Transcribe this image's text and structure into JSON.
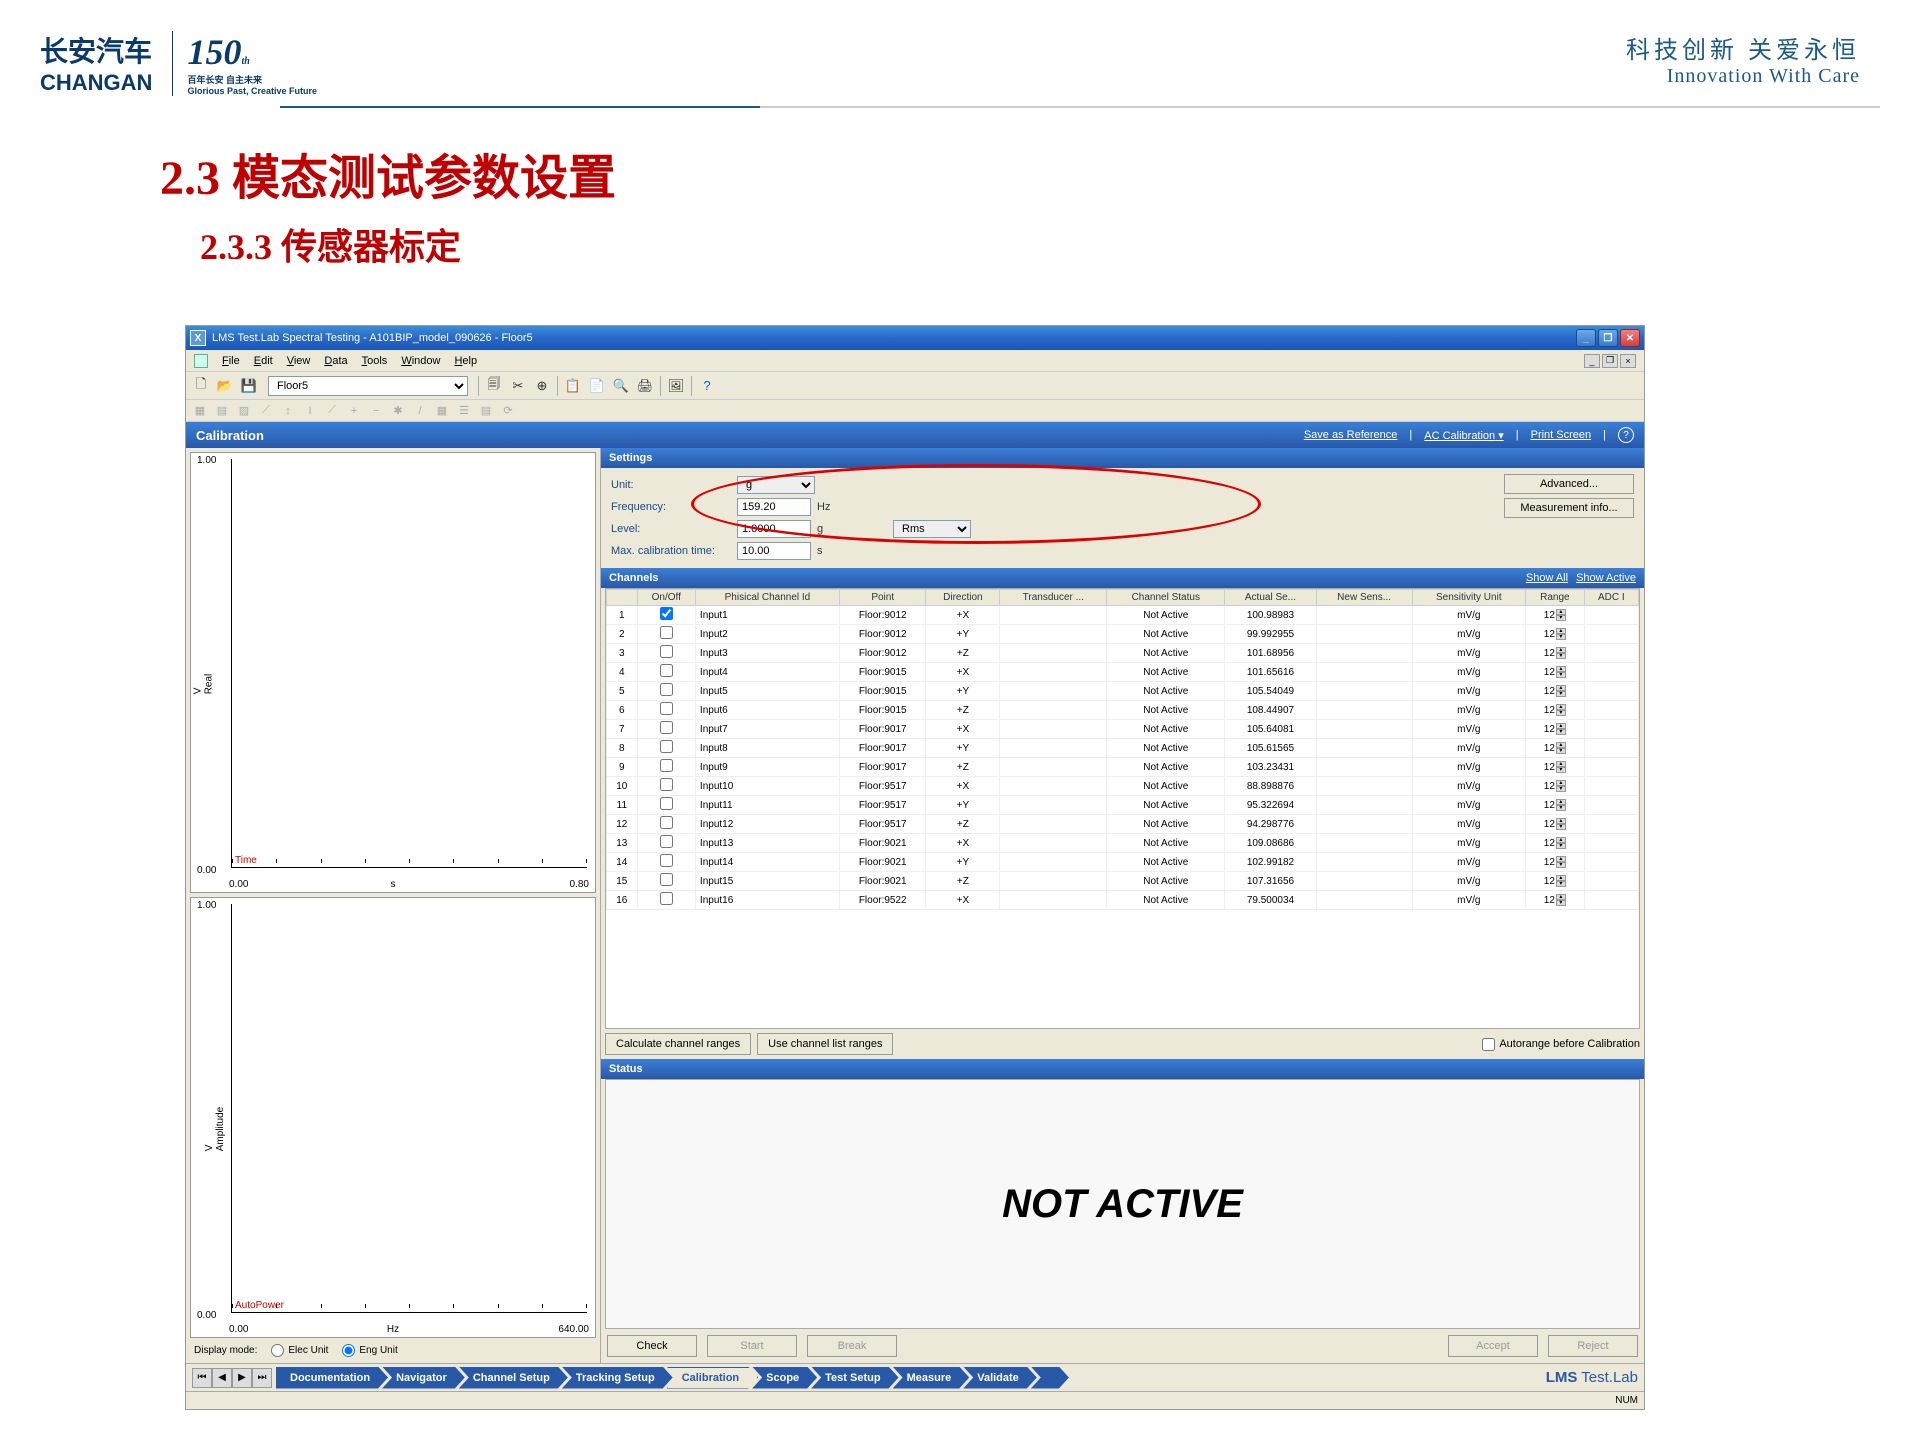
{
  "slide": {
    "logo_cn": "长安汽车",
    "logo_en": "CHANGAN",
    "logo_150": "150",
    "logo_sub1": "百年长安  自主未来",
    "logo_sub2": "Glorious Past, Creative Future",
    "slogan_cn": "科技创新  关爱永恒",
    "slogan_en": "Innovation With Care",
    "title": "2.3 模态测试参数设置",
    "subtitle": "2.3.3 传感器标定"
  },
  "window": {
    "title": "LMS Test.Lab Spectral Testing - A101BIP_model_090626 - Floor5",
    "section_dropdown": "Floor5"
  },
  "menus": [
    "File",
    "Edit",
    "View",
    "Data",
    "Tools",
    "Window",
    "Help"
  ],
  "calibration": {
    "header": "Calibration",
    "save_ref": "Save as Reference",
    "ac_cal": "AC Calibration",
    "print": "Print Screen"
  },
  "settings": {
    "header": "Settings",
    "unit_label": "Unit:",
    "unit_value": "g",
    "freq_label": "Frequency:",
    "freq_value": "159.20",
    "freq_unit": "Hz",
    "level_label": "Level:",
    "level_value": "1.0000",
    "level_unit": "g",
    "level_type": "Rms",
    "calib_label": "Max. calibration time:",
    "calib_value": "10.00",
    "calib_unit": "s",
    "btn_advanced": "Advanced...",
    "btn_measinfo": "Measurement info..."
  },
  "channels": {
    "header": "Channels",
    "show_all": "Show All",
    "show_active": "Show Active",
    "cols": [
      "",
      "On/Off",
      "Phisical Channel Id",
      "Point",
      "Direction",
      "Transducer ...",
      "Channel Status",
      "Actual Se...",
      "New Sens...",
      "Sensitivity Unit",
      "Range",
      "ADC I"
    ],
    "rows": [
      {
        "n": 1,
        "on": true,
        "id": "Input1",
        "point": "Floor:9012",
        "dir": "+X",
        "status": "Not Active",
        "actual": "100.98983",
        "sens": "mV/g",
        "range": "12"
      },
      {
        "n": 2,
        "on": false,
        "id": "Input2",
        "point": "Floor:9012",
        "dir": "+Y",
        "status": "Not Active",
        "actual": "99.992955",
        "sens": "mV/g",
        "range": "12"
      },
      {
        "n": 3,
        "on": false,
        "id": "Input3",
        "point": "Floor:9012",
        "dir": "+Z",
        "status": "Not Active",
        "actual": "101.68956",
        "sens": "mV/g",
        "range": "12"
      },
      {
        "n": 4,
        "on": false,
        "id": "Input4",
        "point": "Floor:9015",
        "dir": "+X",
        "status": "Not Active",
        "actual": "101.65616",
        "sens": "mV/g",
        "range": "12"
      },
      {
        "n": 5,
        "on": false,
        "id": "Input5",
        "point": "Floor:9015",
        "dir": "+Y",
        "status": "Not Active",
        "actual": "105.54049",
        "sens": "mV/g",
        "range": "12"
      },
      {
        "n": 6,
        "on": false,
        "id": "Input6",
        "point": "Floor:9015",
        "dir": "+Z",
        "status": "Not Active",
        "actual": "108.44907",
        "sens": "mV/g",
        "range": "12"
      },
      {
        "n": 7,
        "on": false,
        "id": "Input7",
        "point": "Floor:9017",
        "dir": "+X",
        "status": "Not Active",
        "actual": "105.64081",
        "sens": "mV/g",
        "range": "12"
      },
      {
        "n": 8,
        "on": false,
        "id": "Input8",
        "point": "Floor:9017",
        "dir": "+Y",
        "status": "Not Active",
        "actual": "105.61565",
        "sens": "mV/g",
        "range": "12"
      },
      {
        "n": 9,
        "on": false,
        "id": "Input9",
        "point": "Floor:9017",
        "dir": "+Z",
        "status": "Not Active",
        "actual": "103.23431",
        "sens": "mV/g",
        "range": "12"
      },
      {
        "n": 10,
        "on": false,
        "id": "Input10",
        "point": "Floor:9517",
        "dir": "+X",
        "status": "Not Active",
        "actual": "88.898876",
        "sens": "mV/g",
        "range": "12"
      },
      {
        "n": 11,
        "on": false,
        "id": "Input11",
        "point": "Floor:9517",
        "dir": "+Y",
        "status": "Not Active",
        "actual": "95.322694",
        "sens": "mV/g",
        "range": "12"
      },
      {
        "n": 12,
        "on": false,
        "id": "Input12",
        "point": "Floor:9517",
        "dir": "+Z",
        "status": "Not Active",
        "actual": "94.298776",
        "sens": "mV/g",
        "range": "12"
      },
      {
        "n": 13,
        "on": false,
        "id": "Input13",
        "point": "Floor:9021",
        "dir": "+X",
        "status": "Not Active",
        "actual": "109.08686",
        "sens": "mV/g",
        "range": "12"
      },
      {
        "n": 14,
        "on": false,
        "id": "Input14",
        "point": "Floor:9021",
        "dir": "+Y",
        "status": "Not Active",
        "actual": "102.99182",
        "sens": "mV/g",
        "range": "12"
      },
      {
        "n": 15,
        "on": false,
        "id": "Input15",
        "point": "Floor:9021",
        "dir": "+Z",
        "status": "Not Active",
        "actual": "107.31656",
        "sens": "mV/g",
        "range": "12"
      },
      {
        "n": 16,
        "on": false,
        "id": "Input16",
        "point": "Floor:9522",
        "dir": "+X",
        "status": "Not Active",
        "actual": "79.500034",
        "sens": "mV/g",
        "range": "12"
      }
    ],
    "btn_calc": "Calculate channel ranges",
    "btn_uselist": "Use channel list ranges",
    "chk_autorange": "Autorange before Calibration"
  },
  "status": {
    "header": "Status",
    "text": "NOT ACTIVE"
  },
  "actions": {
    "check": "Check",
    "start": "Start",
    "break": "Break",
    "accept": "Accept",
    "reject": "Reject"
  },
  "tabs": [
    "Documentation",
    "Navigator",
    "Channel Setup",
    "Tracking Setup",
    "Calibration",
    "Scope",
    "Test Setup",
    "Measure",
    "Validate"
  ],
  "tabs_active": "Calibration",
  "lms_brand": {
    "bold": "LMS",
    "rest": " Test.Lab"
  },
  "charts": {
    "c1": {
      "ytop": "1.00",
      "ybot": "0.00",
      "x0": "0.00",
      "x1": "0.80",
      "xlabel": "s",
      "ylabel": "V\nReal",
      "series": "Time"
    },
    "c2": {
      "ytop": "1.00",
      "ybot": "0.00",
      "x0": "0.00",
      "x1": "640.00",
      "xlabel": "Hz",
      "ylabel": "V\nAmplitude",
      "series": "AutoPower"
    }
  },
  "display_mode": {
    "label": "Display mode:",
    "opt1": "Elec Unit",
    "opt2": "Eng Unit"
  },
  "bottom_status": "NUM"
}
